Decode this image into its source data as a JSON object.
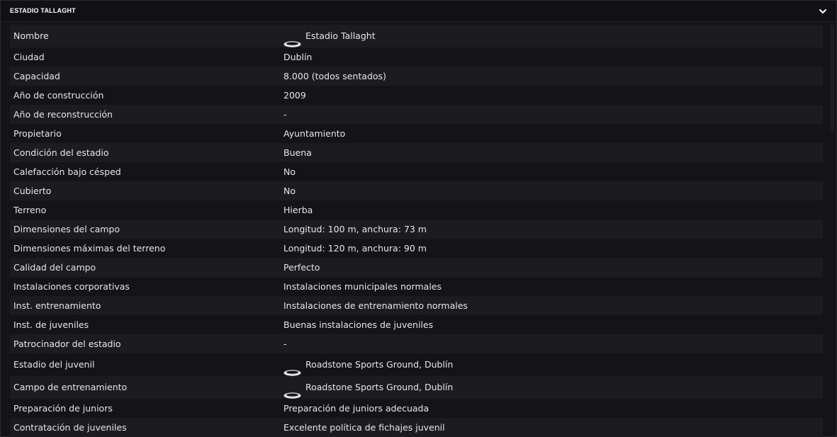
{
  "panel": {
    "title": "ESTADIO TALLAGHT",
    "collapse_icon": "chevron-down-icon"
  },
  "rows": [
    {
      "label": "Nombre",
      "value": "Estadio Tallaght",
      "icon": "stadium-icon"
    },
    {
      "label": "Ciudad",
      "value": "Dublín"
    },
    {
      "label": "Capacidad",
      "value": "8.000 (todos sentados)"
    },
    {
      "label": "Año de construcción",
      "value": "2009"
    },
    {
      "label": "Año de reconstrucción",
      "value": "-"
    },
    {
      "label": "Propietario",
      "value": "Ayuntamiento"
    },
    {
      "label": "Condición del estadio",
      "value": "Buena"
    },
    {
      "label": "Calefacción bajo césped",
      "value": "No"
    },
    {
      "label": "Cubierto",
      "value": "No"
    },
    {
      "label": "Terreno",
      "value": "Hierba"
    },
    {
      "label": "Dimensiones del campo",
      "value": "Longitud: 100 m, anchura: 73 m"
    },
    {
      "label": "Dimensiones máximas del terreno",
      "value": "Longitud: 120 m, anchura: 90 m"
    },
    {
      "label": "Calidad del campo",
      "value": "Perfecto"
    },
    {
      "label": "Instalaciones corporativas",
      "value": "Instalaciones municipales normales"
    },
    {
      "label": "Inst. entrenamiento",
      "value": "Instalaciones de entrenamiento normales"
    },
    {
      "label": "Inst. de juveniles",
      "value": "Buenas instalaciones de juveniles"
    },
    {
      "label": "Patrocinador del estadio",
      "value": "-"
    },
    {
      "label": "Estadio del juvenil",
      "value": "Roadstone Sports Ground, Dublín",
      "icon": "stadium-icon"
    },
    {
      "label": "Campo de entrenamiento",
      "value": "Roadstone Sports Ground, Dublín",
      "icon": "stadium-icon"
    },
    {
      "label": "Preparación de juniors",
      "value": "Preparación de juniors adecuada"
    },
    {
      "label": "Contratación de juveniles",
      "value": "Excelente política de fichajes juvenil"
    }
  ],
  "colors": {
    "background": "#141417",
    "row_alt": "#1c1c20",
    "text": "#e6e6e6",
    "header_text": "#ffffff"
  }
}
